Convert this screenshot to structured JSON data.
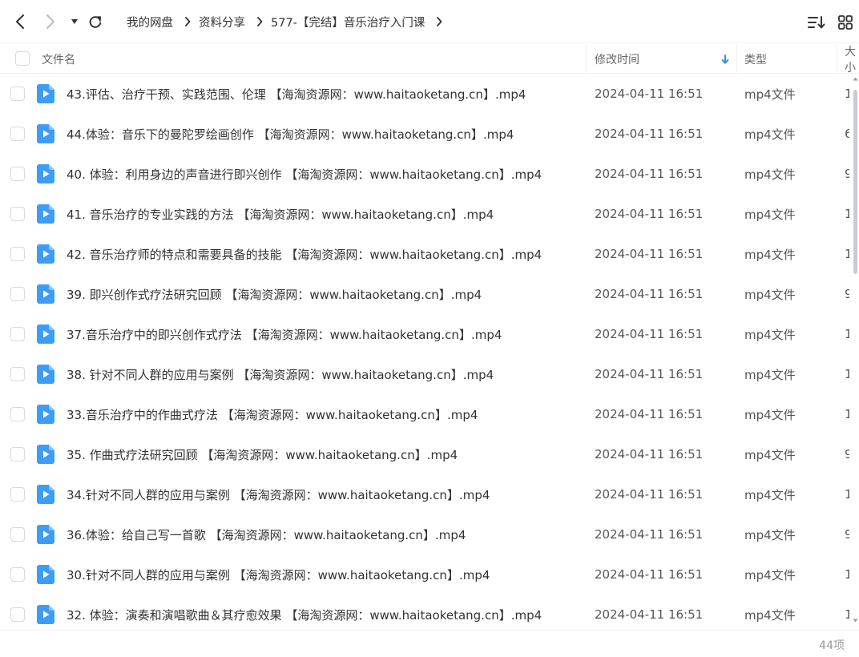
{
  "toolbar": {
    "breadcrumb": [
      "我的网盘",
      "资料分享",
      "577-【完结】音乐治疗入门课"
    ]
  },
  "table": {
    "headers": {
      "name": "文件名",
      "time": "修改时间",
      "type": "类型",
      "size": "大小"
    },
    "sort": "modified-time-descending",
    "rows": [
      {
        "name": "43.评估、治疗干预、实践范围、伦理 【海淘资源网：www.haitaoketang.cn】.mp4",
        "time": "2024-04-11 16:51",
        "type": "mp4文件",
        "size": "1"
      },
      {
        "name": "44.体验：音乐下的曼陀罗绘画创作 【海淘资源网：www.haitaoketang.cn】.mp4",
        "time": "2024-04-11 16:51",
        "type": "mp4文件",
        "size": "6"
      },
      {
        "name": "40. 体验：利用身边的声音进行即兴创作 【海淘资源网：www.haitaoketang.cn】.mp4",
        "time": "2024-04-11 16:51",
        "type": "mp4文件",
        "size": "9"
      },
      {
        "name": "41. 音乐治疗的专业实践的方法 【海淘资源网：www.haitaoketang.cn】.mp4",
        "time": "2024-04-11 16:51",
        "type": "mp4文件",
        "size": "1"
      },
      {
        "name": "42. 音乐治疗师的特点和需要具备的技能 【海淘资源网：www.haitaoketang.cn】.mp4",
        "time": "2024-04-11 16:51",
        "type": "mp4文件",
        "size": "1"
      },
      {
        "name": "39. 即兴创作式疗法研究回顾 【海淘资源网：www.haitaoketang.cn】.mp4",
        "time": "2024-04-11 16:51",
        "type": "mp4文件",
        "size": "9"
      },
      {
        "name": "37.音乐治疗中的即兴创作式疗法 【海淘资源网：www.haitaoketang.cn】.mp4",
        "time": "2024-04-11 16:51",
        "type": "mp4文件",
        "size": "1"
      },
      {
        "name": "38. 针对不同人群的应用与案例 【海淘资源网：www.haitaoketang.cn】.mp4",
        "time": "2024-04-11 16:51",
        "type": "mp4文件",
        "size": "1"
      },
      {
        "name": "33.音乐治疗中的作曲式疗法 【海淘资源网：www.haitaoketang.cn】.mp4",
        "time": "2024-04-11 16:51",
        "type": "mp4文件",
        "size": "1"
      },
      {
        "name": "35. 作曲式疗法研究回顾 【海淘资源网：www.haitaoketang.cn】.mp4",
        "time": "2024-04-11 16:51",
        "type": "mp4文件",
        "size": "9"
      },
      {
        "name": "34.针对不同人群的应用与案例 【海淘资源网：www.haitaoketang.cn】.mp4",
        "time": "2024-04-11 16:51",
        "type": "mp4文件",
        "size": "1"
      },
      {
        "name": "36.体验：给自己写一首歌 【海淘资源网：www.haitaoketang.cn】.mp4",
        "time": "2024-04-11 16:51",
        "type": "mp4文件",
        "size": "9"
      },
      {
        "name": "30.针对不同人群的应用与案例 【海淘资源网：www.haitaoketang.cn】.mp4",
        "time": "2024-04-11 16:51",
        "type": "mp4文件",
        "size": "1"
      },
      {
        "name": "32. 体验：演奏和演唱歌曲＆其疗愈效果 【海淘资源网：www.haitaoketang.cn】.mp4",
        "time": "2024-04-11 16:51",
        "type": "mp4文件",
        "size": "1"
      }
    ]
  },
  "footer": {
    "count": "44项"
  },
  "colors": {
    "accent": "#2f8ff2",
    "file_icon": "#3d9df5",
    "divider": "#eef0f3"
  },
  "icons": {
    "back": "chevron-left-icon",
    "forward": "chevron-right-icon",
    "history": "caret-down-icon",
    "refresh": "refresh-icon",
    "sort": "sort-list-icon",
    "view": "grid-view-icon",
    "file": "video-file-icon"
  }
}
